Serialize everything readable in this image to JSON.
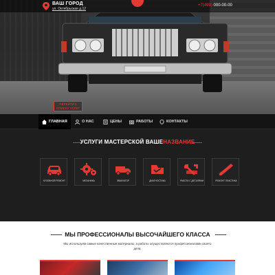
{
  "header": {
    "city": "ВАШ ГОРОД",
    "address": "ул. Октябрьская д.12",
    "phone_code": "+7(499)",
    "phone_number": "000-00-00",
    "cta_label": "ПЕРЕЙТИ К СПИСКУ УСЛУГ"
  },
  "nav": {
    "items": [
      {
        "label": "ГЛАВНАЯ",
        "icon": "home-icon",
        "active": true
      },
      {
        "label": "О НАС",
        "icon": "user-icon",
        "active": false
      },
      {
        "label": "ЦЕНЫ",
        "icon": "document-icon",
        "active": false
      },
      {
        "label": "РАБОТЫ",
        "icon": "camera-icon",
        "active": false
      },
      {
        "label": "КОНТАКТЫ",
        "icon": "location-icon",
        "active": false
      }
    ]
  },
  "services": {
    "title_main": "УСЛУГИ МАСТЕРСКОЙ ",
    "title_brand_a": "ВАШЕ",
    "title_brand_b": "НАЗВАНИЕ",
    "items": [
      {
        "label": "КУЗОВНОЙ РЕМОНТ",
        "icon": "car-icon"
      },
      {
        "label": "МЕХАНИКА",
        "icon": "gears-icon"
      },
      {
        "label": "ЭВАКУАТОР",
        "icon": "truck-icon"
      },
      {
        "label": "ДИАГНОСТИКА",
        "icon": "diagnostics-icon"
      },
      {
        "label": "РАБОТА С ДЕТАЛЯМИ",
        "icon": "wrench-icon"
      },
      {
        "label": "РЕМОНТ ПЛАСТИКА",
        "icon": "brush-icon"
      }
    ]
  },
  "pro": {
    "title": "МЫ ПРОФЕССИОНАЛЫ ВЫСОЧАЙШЕГО КЛАССА",
    "text": "Мы используем самые качественные материалы, а работы осуществляются профессионалами своего дела."
  },
  "colors": {
    "accent": "#e53935",
    "dark": "#1e1e1e",
    "nav_bg": "#141414"
  }
}
